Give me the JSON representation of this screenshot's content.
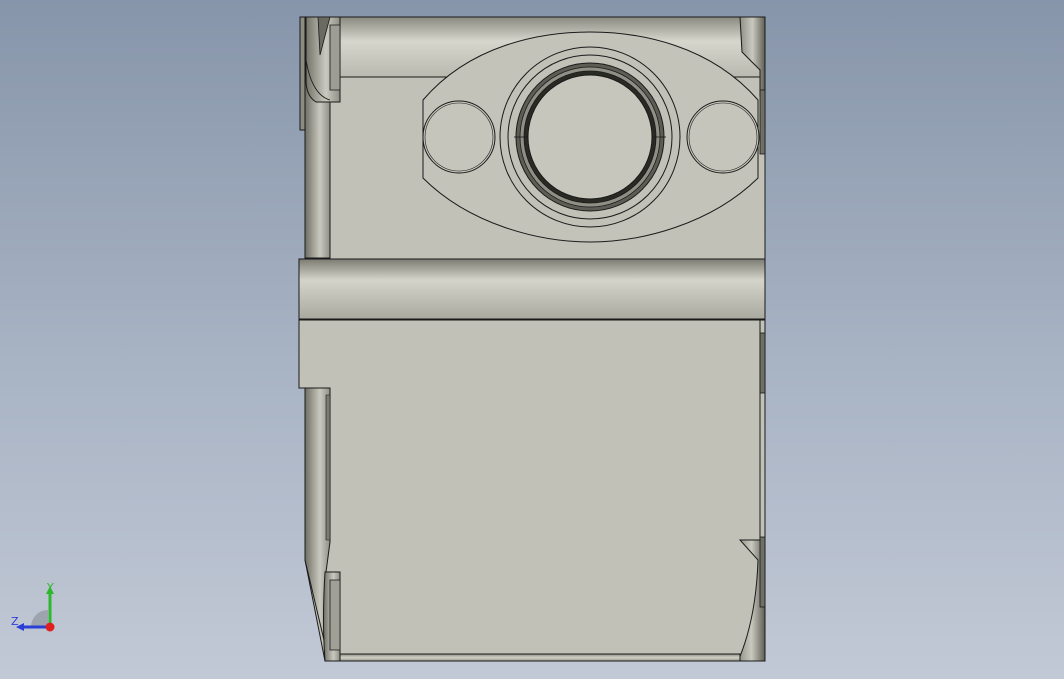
{
  "viewport": {
    "background_top": "#8795aa",
    "background_bottom": "#c2c9d6"
  },
  "model": {
    "face_color": "#c1c1b7",
    "edge_color": "#1a1a1a",
    "shadow_color": "#4a4a42"
  },
  "triad": {
    "y_label": "Y",
    "z_label": "Z",
    "y_color": "#2db82d",
    "z_color": "#2b3fd6",
    "x_color": "#e02020"
  }
}
